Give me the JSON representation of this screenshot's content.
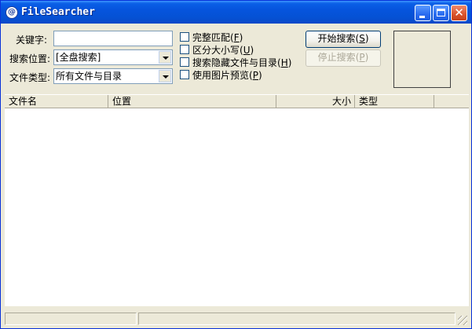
{
  "window": {
    "title": "FileSearcher"
  },
  "form": {
    "keyword_label": "关键字:",
    "keyword_value": "",
    "location_label": "搜索位置:",
    "location_value": "[全盘搜索]",
    "filetype_label": "文件类型:",
    "filetype_value": "所有文件与目录"
  },
  "options": [
    {
      "label": "完整匹配",
      "key": "F",
      "checked": false
    },
    {
      "label": "区分大小写",
      "key": "U",
      "checked": false
    },
    {
      "label": "搜索隐藏文件与目录",
      "key": "H",
      "checked": false
    },
    {
      "label": "使用图片预览",
      "key": "P",
      "checked": false
    }
  ],
  "buttons": {
    "start_label": "开始搜索",
    "start_key": "S",
    "stop_label": "停止搜索",
    "stop_key": "P"
  },
  "table": {
    "columns": [
      "文件名",
      "位置",
      "大小",
      "类型"
    ],
    "rows": []
  },
  "statusbar": {
    "left": "",
    "right": ""
  }
}
